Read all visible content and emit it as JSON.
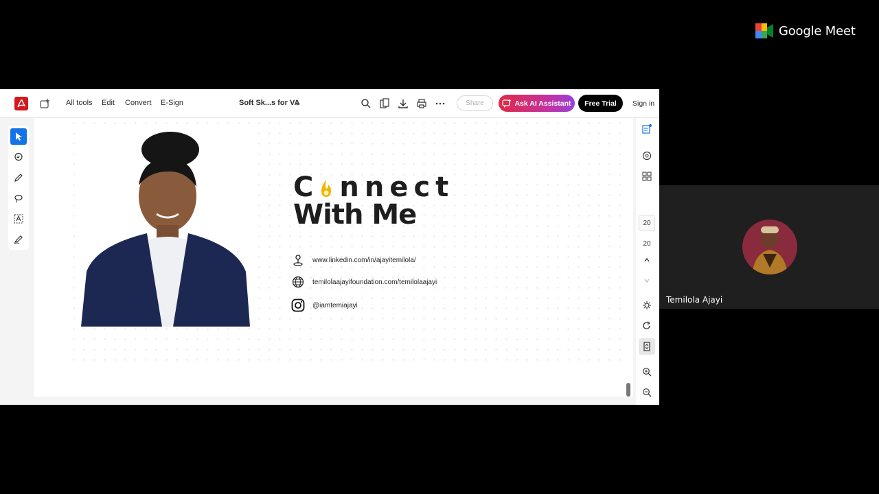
{
  "meet": {
    "brand": "Google Meet",
    "participant_name": "Temilola Ajayi"
  },
  "viewer": {
    "menu": [
      "All tools",
      "Edit",
      "Convert",
      "E-Sign"
    ],
    "doc_title": "Soft Sk...s for VA",
    "share_label": "Share",
    "ai_label": "Ask AI Assistant",
    "trial_label": "Free Trial",
    "signin_label": "Sign in",
    "page_current": "20",
    "page_total": "20"
  },
  "slide": {
    "heading_line1_a": "C",
    "heading_line1_b": "nnect",
    "heading_line2": "With Me",
    "contacts": [
      {
        "icon": "location-pin-icon",
        "text": "www.linkedin.com/in/ajayitemilola/"
      },
      {
        "icon": "globe-icon",
        "text": "temilolaajayifoundation.com/temilolaajayi"
      },
      {
        "icon": "instagram-icon",
        "text": "@iamtemiajayi"
      }
    ]
  },
  "colors": {
    "accent_ai": "#c53199",
    "acrobat_red": "#d4191e",
    "select_blue": "#1473e6",
    "flame_yellow": "#f1b500"
  }
}
